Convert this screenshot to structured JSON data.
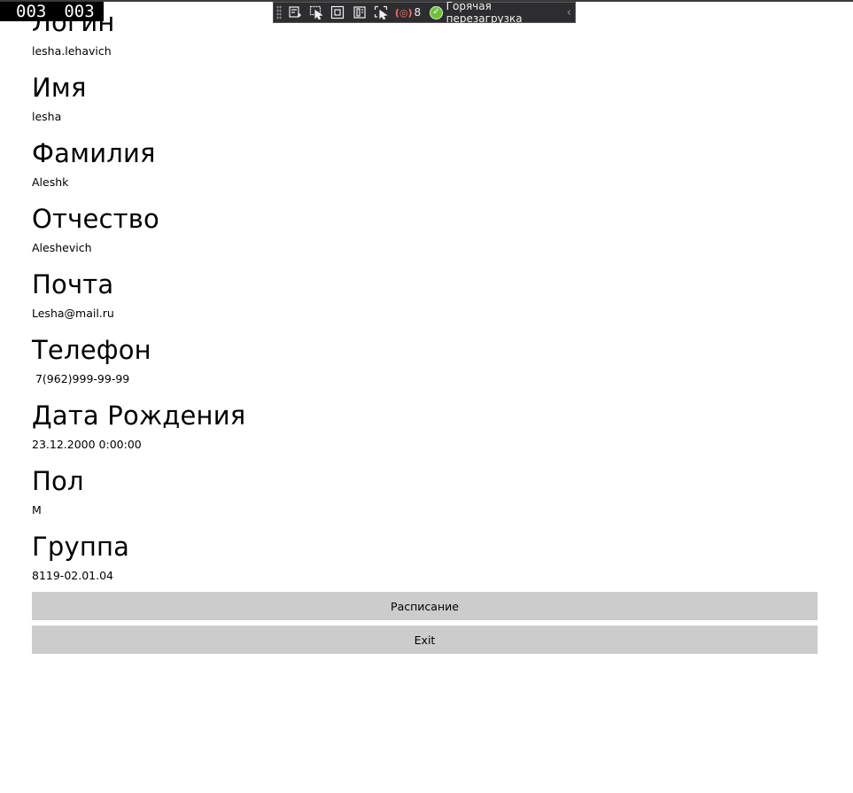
{
  "frame_counter": {
    "left": "003",
    "right": "003"
  },
  "debug_toolbar": {
    "issue_count": "8",
    "hot_reload_label": "Горячая перезагрузка",
    "icons": [
      "live-visual-tree-icon",
      "select-element-icon",
      "display-layout-adorners-icon",
      "track-focus-icon",
      "preview-selection-icon",
      "binding-failures-icon",
      "hot-reload-status-icon",
      "collapse-chevron-icon"
    ]
  },
  "profile": {
    "fields": [
      {
        "label": "Логин",
        "value": "lesha.lehavich"
      },
      {
        "label": "Имя",
        "value": "lesha"
      },
      {
        "label": "Фамилия",
        "value": "Aleshk"
      },
      {
        "label": "Отчество",
        "value": "Aleshevich"
      },
      {
        "label": "Почта",
        "value": "Lesha@mail.ru"
      },
      {
        "label": "Телефон",
        "value": " 7(962)999-99-99"
      },
      {
        "label": "Дата Рождения",
        "value": "23.12.2000 0:00:00"
      },
      {
        "label": "Пол",
        "value": "M"
      },
      {
        "label": "Группа",
        "value": "8119-02.01.04"
      }
    ]
  },
  "buttons": {
    "schedule_label": "Расписание",
    "exit_label": "Exit"
  },
  "colors": {
    "button_background": "#cccccc",
    "toolbar_background": "#2d2d30",
    "hot_reload_ok": "#6fbf3b"
  }
}
